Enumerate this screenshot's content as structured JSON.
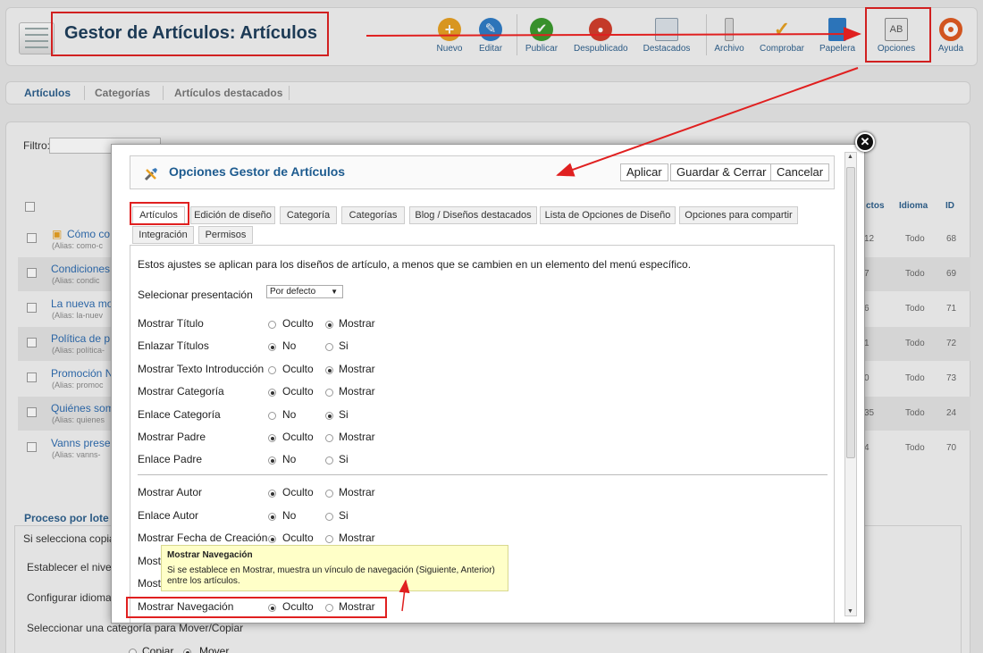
{
  "header": {
    "title": "Gestor de Artículos: Artículos",
    "toolbar": [
      {
        "label": "Nuevo",
        "icon": "plus-circle-icon",
        "color": "#e8a020"
      },
      {
        "label": "Editar",
        "icon": "pencil-icon",
        "color": "#2d7bc6"
      },
      {
        "label": "Publicar",
        "icon": "check-circle-icon",
        "color": "#3a9a2c"
      },
      {
        "label": "Despublicado",
        "icon": "stop-circle-icon",
        "color": "#d23c2a"
      },
      {
        "label": "Destacados",
        "icon": "featured-icon",
        "color": "#8899aa"
      },
      {
        "label": "Archivo",
        "icon": "archive-icon",
        "color": "#999999"
      },
      {
        "label": "Comprobar",
        "icon": "checkmark-icon",
        "color": "#e8a020"
      },
      {
        "label": "Papelera",
        "icon": "trash-icon",
        "color": "#2d7bc6"
      },
      {
        "label": "Opciones",
        "icon": "options-icon",
        "color": "#888888"
      },
      {
        "label": "Ayuda",
        "icon": "help-lifebuoy-icon",
        "color": "#e05a20"
      }
    ]
  },
  "subnav": [
    "Artículos",
    "Categorías",
    "Artículos destacados"
  ],
  "filter_label": "Filtro:",
  "table": {
    "headers": {
      "count": "ctos",
      "language": "Idioma",
      "id": "ID"
    },
    "rows": [
      {
        "title": "Cómo co",
        "alias": "(Alias: como-c",
        "count": "12",
        "language": "Todo",
        "id": "68"
      },
      {
        "title": "Condiciones",
        "alias": "(Alias: condic",
        "count": "7",
        "language": "Todo",
        "id": "69"
      },
      {
        "title": "La nueva mo",
        "alias": "(Alias: la-nuev",
        "count": "6",
        "language": "Todo",
        "id": "71"
      },
      {
        "title": "Política de p",
        "alias": "(Alias: política-",
        "count": "1",
        "language": "Todo",
        "id": "72"
      },
      {
        "title": "Promoción N",
        "alias": "(Alias: promoc",
        "count": "0",
        "language": "Todo",
        "id": "73"
      },
      {
        "title": "Quiénes som",
        "alias": "(Alias: quienes",
        "count": "35",
        "language": "Todo",
        "id": "24"
      },
      {
        "title": "Vanns prese",
        "alias": "(Alias: vanns-",
        "count": "4",
        "language": "Todo",
        "id": "70"
      }
    ]
  },
  "batch": {
    "title": "Proceso por lote",
    "lines": [
      "Si selecciona copia",
      "Establecer el nivel",
      "Configurar idioma",
      "Seleccionar una categoría para Mover/Copiar"
    ],
    "copy_label": "Copiar",
    "move_label": "Mover"
  },
  "modal": {
    "title": "Opciones Gestor de Artículos",
    "apply_label": "Aplicar",
    "save_close_label": "Guardar & Cerrar",
    "cancel_label": "Cancelar",
    "close_glyph": "✕",
    "tabs": [
      "Artículos",
      "Edición de diseño",
      "Categoría",
      "Categorías",
      "Blog / Diseños destacados",
      "Lista de Opciones de Diseño",
      "Opciones para compartir",
      "Integración",
      "Permisos"
    ],
    "description": "Estos ajustes se aplican para los diseños de artículo, a menos que se cambien en un elemento del menú específico.",
    "layout_label": "Selecionar presentación",
    "layout_value": "Por defecto",
    "options": [
      {
        "label": "Mostrar Título",
        "a": "Oculto",
        "b": "Mostrar",
        "selected": "b"
      },
      {
        "label": "Enlazar Títulos",
        "a": "No",
        "b": "Si",
        "selected": "a"
      },
      {
        "label": "Mostrar Texto Introducción",
        "a": "Oculto",
        "b": "Mostrar",
        "selected": "b"
      },
      {
        "label": "Mostrar Categoría",
        "a": "Oculto",
        "b": "Mostrar",
        "selected": "a"
      },
      {
        "label": "Enlace Categoría",
        "a": "No",
        "b": "Si",
        "selected": "b"
      },
      {
        "label": "Mostrar Padre",
        "a": "Oculto",
        "b": "Mostrar",
        "selected": "a"
      },
      {
        "label": "Enlace Padre",
        "a": "No",
        "b": "Si",
        "selected": "a"
      },
      {
        "label": "Mostrar Autor",
        "a": "Oculto",
        "b": "Mostrar",
        "selected": "a"
      },
      {
        "label": "Enlace Autor",
        "a": "No",
        "b": "Si",
        "selected": "a"
      },
      {
        "label": "Mostrar Fecha de Creación",
        "a": "Oculto",
        "b": "Mostrar",
        "selected": "a"
      },
      {
        "label": "Mostr",
        "a": "",
        "b": "",
        "selected": ""
      },
      {
        "label": "Mostr",
        "a": "",
        "b": "",
        "selected": ""
      },
      {
        "label": "Mostrar Navegación",
        "a": "Oculto",
        "b": "Mostrar",
        "selected": "a"
      }
    ]
  },
  "tooltip": {
    "title": "Mostrar Navegación",
    "body": "Si se establece en Mostrar, muestra un vínculo de navegación (Siguiente, Anterior) entre los artículos."
  },
  "annotation_color": "#e02020"
}
